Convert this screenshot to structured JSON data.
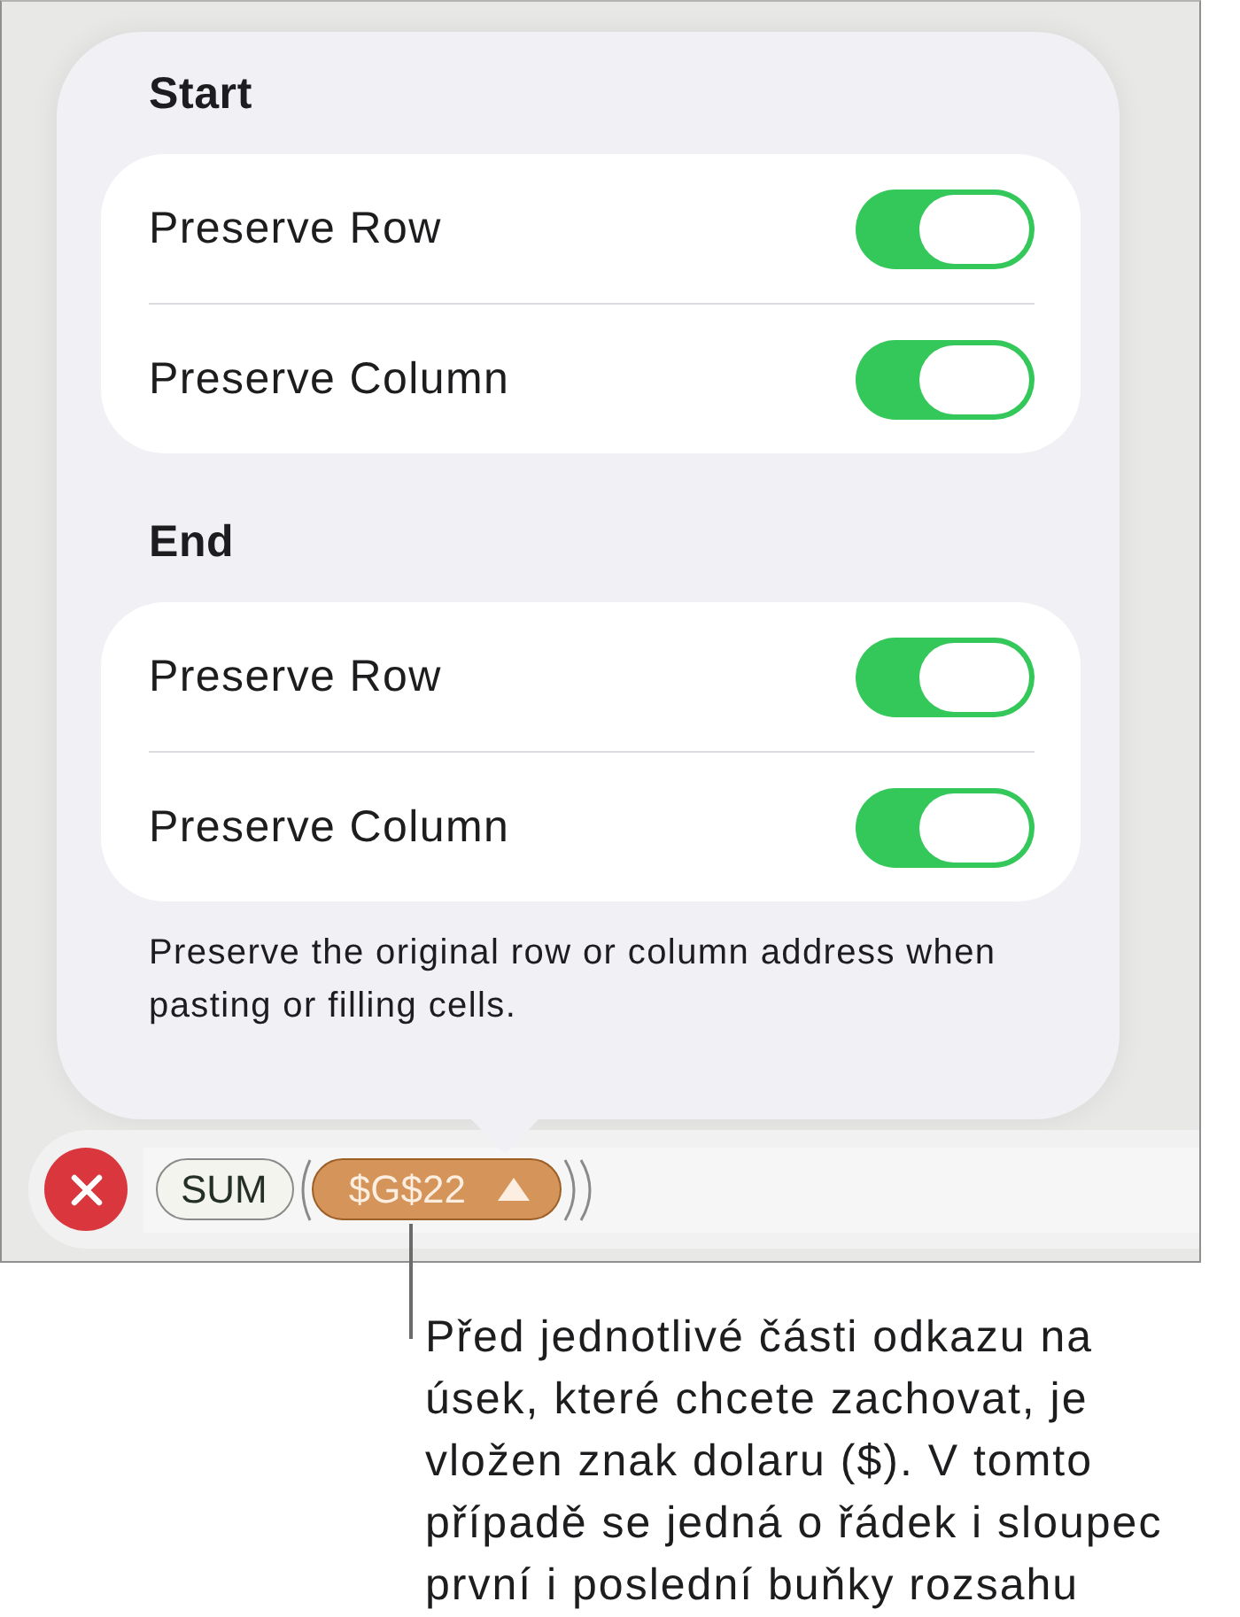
{
  "popover": {
    "sections": [
      {
        "title": "Start",
        "rows": [
          {
            "label": "Preserve Row",
            "on": true
          },
          {
            "label": "Preserve Column",
            "on": true
          }
        ]
      },
      {
        "title": "End",
        "rows": [
          {
            "label": "Preserve Row",
            "on": true
          },
          {
            "label": "Preserve Column",
            "on": true
          }
        ]
      }
    ],
    "footer": "Preserve the original row or column address when pasting or filling cells."
  },
  "formula_bar": {
    "tokens": [
      {
        "kind": "function",
        "text": "SUM",
        "selected": false,
        "arguments": [
          {
            "kind": "reference",
            "text": "$G$22",
            "selected": true
          }
        ]
      }
    ]
  },
  "callout": {
    "text": "Před jednotlivé části odkazu na úsek, které chcete zachovat, je vložen znak dolaru ($). V tomto případě se jedná o řádek i sloupec první i poslední buňky rozsahu"
  }
}
